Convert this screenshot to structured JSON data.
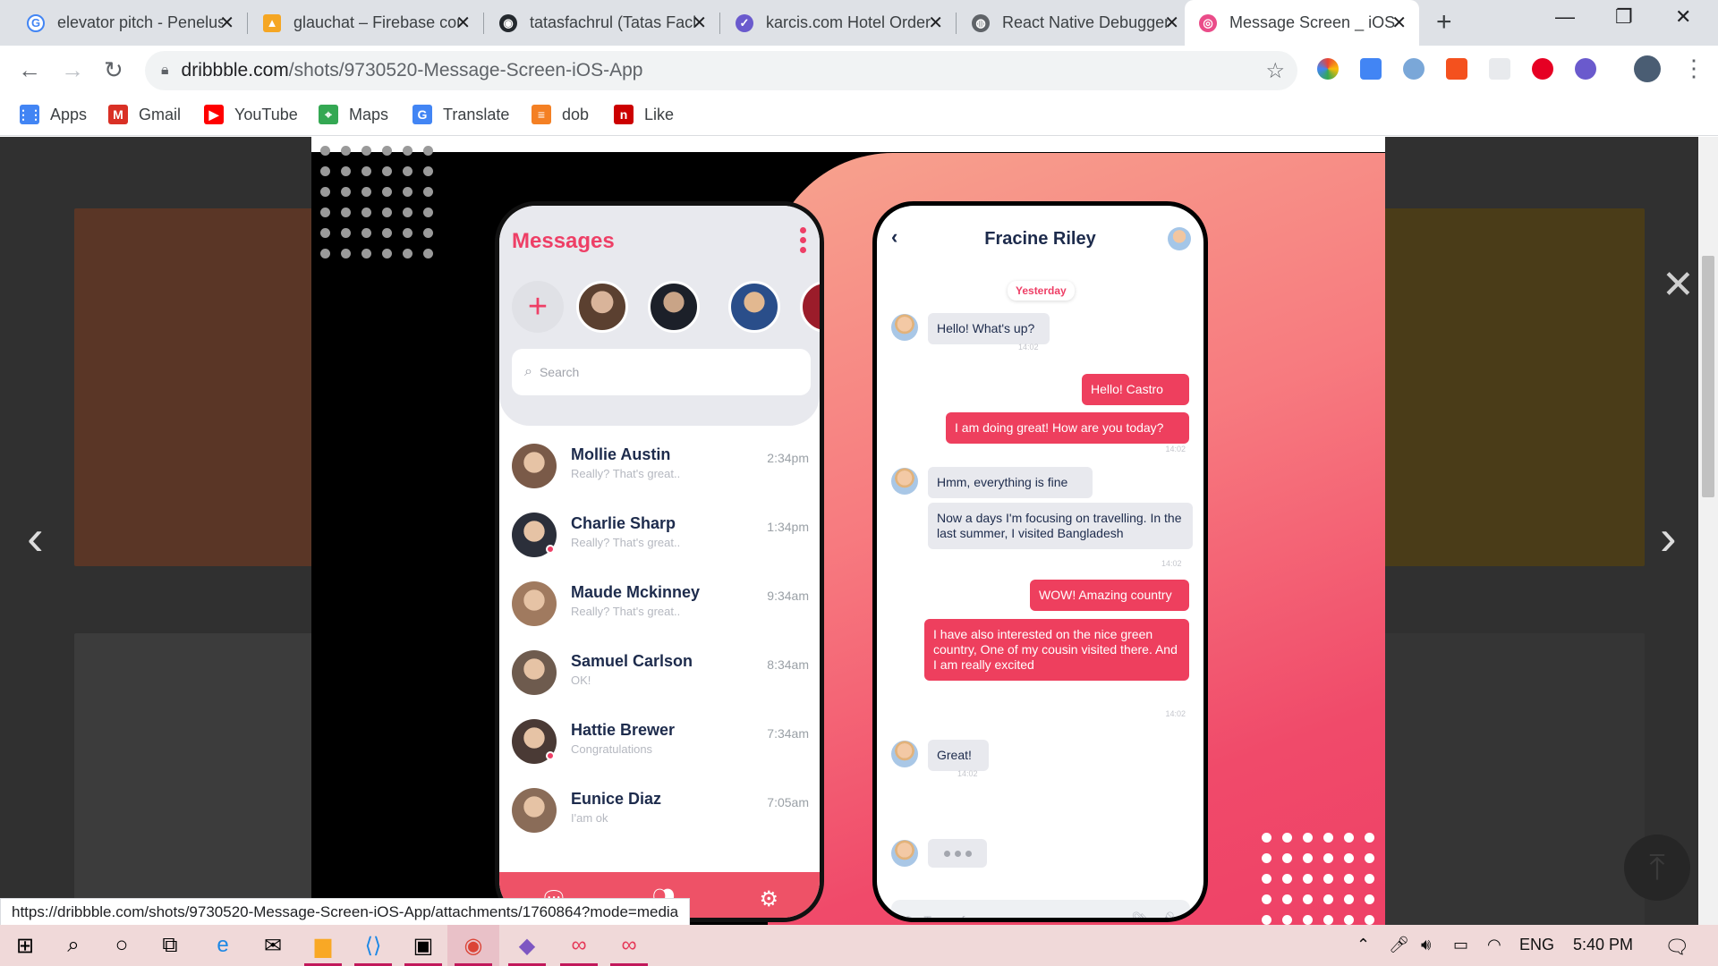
{
  "browser": {
    "tabs": [
      {
        "title": "elevator pitch - Penelusuran Google",
        "icon": "google-icon",
        "color": "#4285f4",
        "glyph": "G"
      },
      {
        "title": "glauchat – Firebase console",
        "icon": "firebase-icon",
        "color": "#f5a623",
        "glyph": "▲"
      },
      {
        "title": "tatasfachrul (Tatas Fachrul)",
        "icon": "github-icon",
        "color": "#24292e",
        "glyph": "◉"
      },
      {
        "title": "karcis.com Hotel Order",
        "icon": "karcis-icon",
        "color": "#6a5acd",
        "glyph": "✓"
      },
      {
        "title": "React Native Debugger",
        "icon": "globe-icon",
        "color": "#5f6368",
        "glyph": "◍"
      },
      {
        "title": "Message Screen _ iOS App",
        "icon": "dribbble-icon",
        "color": "#ea4c89",
        "glyph": "◎",
        "active": true
      }
    ],
    "url_domain": "dribbble.com",
    "url_path": "/shots/9730520-Message-Screen-iOS-App",
    "bookmarks": [
      {
        "label": "Apps",
        "icon": "apps-grid-icon",
        "color": "#4285f4",
        "glyph": "⋮⋮"
      },
      {
        "label": "Gmail",
        "icon": "gmail-icon",
        "color": "#d93025",
        "glyph": "M"
      },
      {
        "label": "YouTube",
        "icon": "youtube-icon",
        "color": "#ff0000",
        "glyph": "▶"
      },
      {
        "label": "Maps",
        "icon": "maps-icon",
        "color": "#34a853",
        "glyph": "⌖"
      },
      {
        "label": "Translate",
        "icon": "translate-icon",
        "color": "#4285f4",
        "glyph": "G"
      },
      {
        "label": "dob",
        "icon": "stackoverflow-icon",
        "color": "#f48024",
        "glyph": "≡"
      },
      {
        "label": "Like",
        "icon": "like-icon",
        "color": "#cc0000",
        "glyph": "n"
      }
    ],
    "status_url": "https://dribbble.com/shots/9730520-Message-Screen-iOS-App/attachments/1760864?mode=media"
  },
  "messages_screen": {
    "title": "Messages",
    "search_placeholder": "Search",
    "chats": [
      {
        "name": "Mollie Austin",
        "preview": "Really? That's great..",
        "time": "2:34pm",
        "online": false,
        "avatar": "#7a5a48"
      },
      {
        "name": "Charlie Sharp",
        "preview": "Really? That's great..",
        "time": "1:34pm",
        "online": true,
        "avatar": "#2b2f3a"
      },
      {
        "name": "Maude Mckinney",
        "preview": "Really? That's great..",
        "time": "9:34am",
        "online": false,
        "avatar": "#a07a5f"
      },
      {
        "name": "Samuel Carlson",
        "preview": "OK!",
        "time": "8:34am",
        "online": false,
        "avatar": "#6e5b4e"
      },
      {
        "name": "Hattie Brewer",
        "preview": "Congratulations",
        "time": "7:34am",
        "online": true,
        "avatar": "#4a3a35"
      },
      {
        "name": "Eunice Diaz",
        "preview": "I'am ok",
        "time": "7:05am",
        "online": false,
        "avatar": "#8a6c58"
      }
    ]
  },
  "chat_screen": {
    "contact": "Fracine Riley",
    "day": "Yesterday",
    "messages": [
      {
        "text": "Hello! What's up?",
        "dir": "in",
        "stamp": "14:02"
      },
      {
        "text": "Hello! Castro",
        "dir": "out",
        "stamp": ""
      },
      {
        "text": "I am doing great! How are you today?",
        "dir": "out",
        "stamp": "14:02"
      },
      {
        "text": "Hmm, everything is fine",
        "dir": "in",
        "stamp": ""
      },
      {
        "text": "Now a days I'm focusing on travelling. In the last summer, I visited Bangladesh",
        "dir": "in",
        "stamp": "14:02"
      },
      {
        "text": "WOW! Amazing country",
        "dir": "out",
        "stamp": ""
      },
      {
        "text": "I have also interested on the nice green country, One of my cousin visited there. And I am really excited",
        "dir": "out",
        "stamp": "14:02"
      },
      {
        "text": "Great!",
        "dir": "in",
        "stamp": "14:02"
      }
    ],
    "input_placeholder": "Type of message"
  },
  "taskbar": {
    "language": "ENG",
    "time": "5:40 PM"
  },
  "colors": {
    "accent": "#ee3f66",
    "navy": "#1d2b4c"
  }
}
